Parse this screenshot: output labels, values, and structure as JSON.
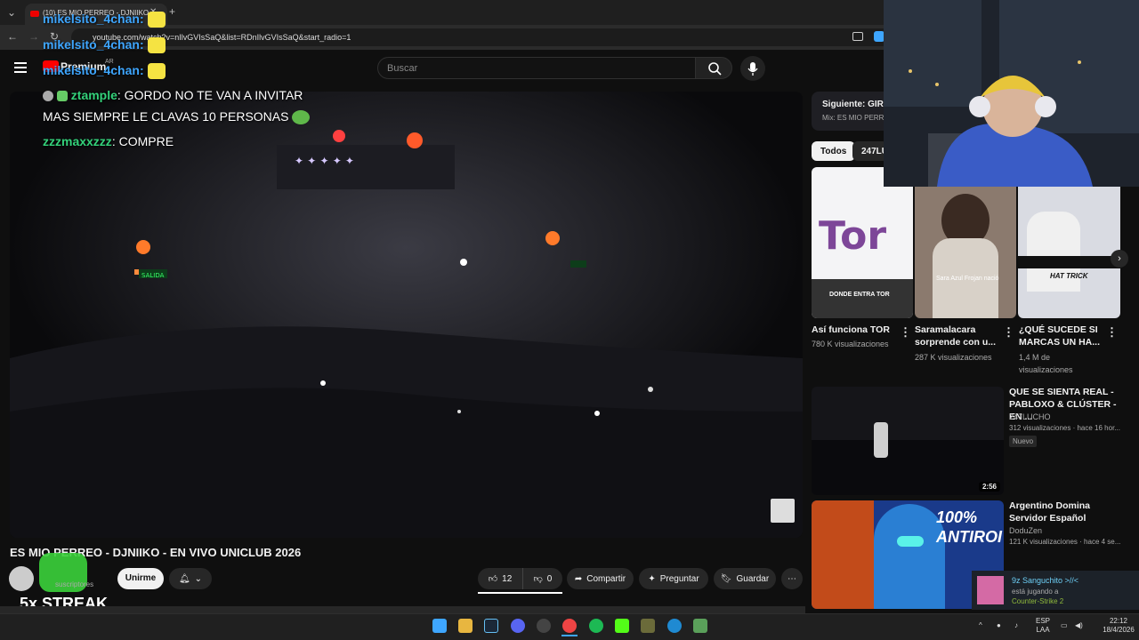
{
  "browser": {
    "tab_title": "(10) ES MIO PERREO - DJNIIKO",
    "url": "youtube.com/watch?v=nIlvGVIsSaQ&list=RDnIlvGVIsSaQ&start_radio=1"
  },
  "header": {
    "logo": "Premium",
    "region": "AR",
    "search_placeholder": "Buscar"
  },
  "chat_overlay": [
    {
      "user": "mikelsito_4chan:",
      "text": ""
    },
    {
      "user": "mikelsito_4chan:",
      "text": ""
    },
    {
      "user": "mikelsito_4chan:",
      "text": ""
    },
    {
      "user": "ztample",
      "text": ": GORDO NO TE VAN A INVITAR"
    },
    {
      "user": "",
      "text": "MAS SIEMPRE LE CLAVAS 10 PERSONAS"
    },
    {
      "user": "zzzmaxxzzz",
      "text": ": COMPRE"
    }
  ],
  "stage": {
    "exit_sign": "SALIDA"
  },
  "video": {
    "title": "ES MIO PERREO - DJNIIKO - EN VIVO UNICLUB 2026",
    "subs_label": "suscriptores",
    "join_label": "Unirme",
    "like_count": "12",
    "dislike_count": "0",
    "share_label": "Compartir",
    "ask_label": "Preguntar",
    "save_label": "Guardar",
    "streak": "5x STREAK"
  },
  "sidebar": {
    "next_label": "Siguiente: GIRAL",
    "mix_label": "Mix: ES MIO PERRE",
    "chips": [
      "Todos",
      "247LU"
    ],
    "shorts": [
      {
        "title": "Así funciona TOR",
        "meta": "780 K visualizaciones",
        "thumb_text": "Tor",
        "thumb_caption": "DONDE ENTRA TOR"
      },
      {
        "title": "Saramalacara sorprende con u...",
        "meta": "287 K visualizaciones",
        "thumb_caption": "Sara Azul Frojan nació"
      },
      {
        "title": "¿QUÉ SUCEDE SI MARCAS UN HA...",
        "meta": "1,4 M de visualizaciones",
        "thumb_caption": "HAT TRICK"
      }
    ],
    "videos": [
      {
        "title": "QUE SE SIENTA REAL - PABLOXO & CLÚSTER - EN ...",
        "channel": "247LUCHO",
        "meta": "312 visualizaciones · hace 16 hor...",
        "badge": "Nuevo",
        "duration": "2:56"
      },
      {
        "title": "Argentino Domina Servidor Español",
        "channel": "DoduZen",
        "meta": "121 K visualizaciones · hace 4 se...",
        "thumb_text": "100% ANTIROI"
      }
    ]
  },
  "friend_notice": {
    "name": "9z Sanguchito >//<",
    "status": "está jugando a",
    "game": "Counter-Strike 2"
  },
  "taskbar": {
    "lang1": "ESP",
    "lang2": "LAA",
    "time": "22:12",
    "date": "18/4/2026"
  }
}
